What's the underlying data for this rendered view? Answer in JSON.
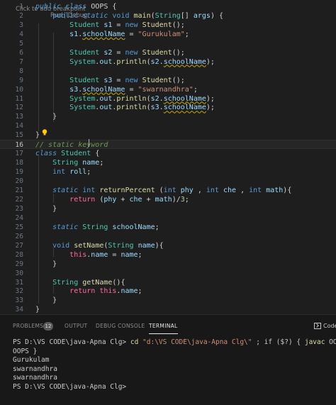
{
  "codelens": {
    "first": "Click to add breakpoint",
    "run_debug": "Run | Debug"
  },
  "code_lines": [
    {
      "n": "1",
      "t": [
        [
          "kw",
          "public"
        ],
        [
          "plain",
          " "
        ],
        [
          "kw",
          "class"
        ],
        [
          "plain",
          " OOPS {"
        ]
      ]
    },
    {
      "n": "2",
      "t": [
        [
          "plain",
          "    "
        ],
        [
          "kw2",
          "public"
        ],
        [
          "plain",
          " "
        ],
        [
          "kw",
          "static"
        ],
        [
          "plain",
          " "
        ],
        [
          "kw2",
          "void"
        ],
        [
          "plain",
          " "
        ],
        [
          "fn",
          "main"
        ],
        [
          "plain",
          "("
        ],
        [
          "ty",
          "String"
        ],
        [
          "plain",
          "[] "
        ],
        [
          "var",
          "args"
        ],
        [
          "plain",
          ") {"
        ]
      ]
    },
    {
      "n": "3",
      "t": [
        [
          "plain",
          "        "
        ],
        [
          "ty",
          "Student"
        ],
        [
          "plain",
          " "
        ],
        [
          "var",
          "s1"
        ],
        [
          "plain",
          " = "
        ],
        [
          "kw2",
          "new"
        ],
        [
          "plain",
          " "
        ],
        [
          "fn",
          "Student"
        ],
        [
          "plain",
          "();"
        ]
      ]
    },
    {
      "n": "4",
      "t": [
        [
          "plain",
          "        "
        ],
        [
          "var",
          "s1"
        ],
        [
          "plain",
          "."
        ],
        [
          "var warn",
          "schoolName"
        ],
        [
          "plain",
          " = "
        ],
        [
          "str",
          "\"Gurukulam\""
        ],
        [
          "plain",
          ";"
        ]
      ]
    },
    {
      "n": "5",
      "t": []
    },
    {
      "n": "6",
      "t": [
        [
          "plain",
          "        "
        ],
        [
          "ty",
          "Student"
        ],
        [
          "plain",
          " "
        ],
        [
          "var",
          "s2"
        ],
        [
          "plain",
          " = "
        ],
        [
          "kw2",
          "new"
        ],
        [
          "plain",
          " "
        ],
        [
          "fn",
          "Student"
        ],
        [
          "plain",
          "();"
        ]
      ]
    },
    {
      "n": "7",
      "t": [
        [
          "plain",
          "        "
        ],
        [
          "ty",
          "System"
        ],
        [
          "plain",
          "."
        ],
        [
          "var",
          "out"
        ],
        [
          "plain",
          "."
        ],
        [
          "fn",
          "println"
        ],
        [
          "plain",
          "("
        ],
        [
          "var",
          "s2"
        ],
        [
          "plain",
          "."
        ],
        [
          "var warn",
          "schoolName"
        ],
        [
          "plain",
          ");"
        ]
      ]
    },
    {
      "n": "8",
      "t": []
    },
    {
      "n": "9",
      "t": [
        [
          "plain",
          "        "
        ],
        [
          "ty",
          "Student"
        ],
        [
          "plain",
          " "
        ],
        [
          "var",
          "s3"
        ],
        [
          "plain",
          " = "
        ],
        [
          "kw2",
          "new"
        ],
        [
          "plain",
          " "
        ],
        [
          "fn",
          "Student"
        ],
        [
          "plain",
          "();"
        ]
      ]
    },
    {
      "n": "10",
      "t": [
        [
          "plain",
          "        "
        ],
        [
          "var",
          "s3"
        ],
        [
          "plain",
          "."
        ],
        [
          "var warn",
          "schoolName"
        ],
        [
          "plain",
          " = "
        ],
        [
          "str",
          "\"swarnandhra\""
        ],
        [
          "plain",
          ";"
        ]
      ]
    },
    {
      "n": "11",
      "t": [
        [
          "plain",
          "        "
        ],
        [
          "ty",
          "System"
        ],
        [
          "plain",
          "."
        ],
        [
          "var",
          "out"
        ],
        [
          "plain",
          "."
        ],
        [
          "fn",
          "println"
        ],
        [
          "plain",
          "("
        ],
        [
          "var",
          "s2"
        ],
        [
          "plain",
          "."
        ],
        [
          "var warn",
          "schoolName"
        ],
        [
          "plain",
          ");"
        ]
      ]
    },
    {
      "n": "12",
      "t": [
        [
          "plain",
          "        "
        ],
        [
          "ty",
          "System"
        ],
        [
          "plain",
          "."
        ],
        [
          "var",
          "out"
        ],
        [
          "plain",
          "."
        ],
        [
          "fn",
          "println"
        ],
        [
          "plain",
          "("
        ],
        [
          "var",
          "s3"
        ],
        [
          "plain",
          "."
        ],
        [
          "var warn",
          "schoolName"
        ],
        [
          "plain",
          ");"
        ]
      ]
    },
    {
      "n": "13",
      "t": [
        [
          "plain",
          "    }"
        ]
      ]
    },
    {
      "n": "14",
      "t": []
    },
    {
      "n": "15",
      "t": [
        [
          "plain",
          "}"
        ]
      ]
    },
    {
      "n": "16",
      "t": [
        [
          "com",
          "// static keyword"
        ]
      ]
    },
    {
      "n": "17",
      "t": [
        [
          "kw",
          "class"
        ],
        [
          "plain",
          " "
        ],
        [
          "ty",
          "Student"
        ],
        [
          "plain",
          " {"
        ]
      ]
    },
    {
      "n": "18",
      "t": [
        [
          "plain",
          "    "
        ],
        [
          "ty",
          "String"
        ],
        [
          "plain",
          " "
        ],
        [
          "var",
          "name"
        ],
        [
          "plain",
          ";"
        ]
      ]
    },
    {
      "n": "19",
      "t": [
        [
          "plain",
          "    "
        ],
        [
          "kw2",
          "int"
        ],
        [
          "plain",
          " "
        ],
        [
          "var",
          "roll"
        ],
        [
          "plain",
          ";"
        ]
      ]
    },
    {
      "n": "20",
      "t": []
    },
    {
      "n": "21",
      "t": [
        [
          "plain",
          "    "
        ],
        [
          "kw",
          "static"
        ],
        [
          "plain",
          " "
        ],
        [
          "kw2",
          "int"
        ],
        [
          "plain",
          " "
        ],
        [
          "fn",
          "returnPercent"
        ],
        [
          "plain",
          " ("
        ],
        [
          "kw2",
          "int"
        ],
        [
          "plain",
          " "
        ],
        [
          "var",
          "phy"
        ],
        [
          "plain",
          " , "
        ],
        [
          "kw2",
          "int"
        ],
        [
          "plain",
          " "
        ],
        [
          "var",
          "che"
        ],
        [
          "plain",
          " , "
        ],
        [
          "kw2",
          "int"
        ],
        [
          "plain",
          " "
        ],
        [
          "var",
          "math"
        ],
        [
          "plain",
          "){"
        ]
      ]
    },
    {
      "n": "22",
      "t": [
        [
          "plain",
          "        "
        ],
        [
          "th",
          "return"
        ],
        [
          "plain",
          " ("
        ],
        [
          "var",
          "phy"
        ],
        [
          "plain",
          " + "
        ],
        [
          "var",
          "che"
        ],
        [
          "plain",
          " + "
        ],
        [
          "var",
          "math"
        ],
        [
          "plain",
          ")/"
        ],
        [
          "num",
          "3"
        ],
        [
          "plain",
          ";"
        ]
      ]
    },
    {
      "n": "23",
      "t": [
        [
          "plain",
          "    }"
        ]
      ]
    },
    {
      "n": "24",
      "t": []
    },
    {
      "n": "25",
      "t": [
        [
          "plain",
          "    "
        ],
        [
          "kw",
          "static"
        ],
        [
          "plain",
          " "
        ],
        [
          "ty",
          "String"
        ],
        [
          "plain",
          " "
        ],
        [
          "var",
          "schoolName"
        ],
        [
          "plain",
          ";"
        ]
      ]
    },
    {
      "n": "26",
      "t": []
    },
    {
      "n": "27",
      "t": [
        [
          "plain",
          "    "
        ],
        [
          "kw2",
          "void"
        ],
        [
          "plain",
          " "
        ],
        [
          "fn",
          "setName"
        ],
        [
          "plain",
          "("
        ],
        [
          "ty",
          "String"
        ],
        [
          "plain",
          " "
        ],
        [
          "var",
          "name"
        ],
        [
          "plain",
          "){"
        ]
      ]
    },
    {
      "n": "28",
      "t": [
        [
          "plain",
          "        "
        ],
        [
          "th",
          "this"
        ],
        [
          "plain",
          "."
        ],
        [
          "var",
          "name"
        ],
        [
          "plain",
          " = "
        ],
        [
          "var",
          "name"
        ],
        [
          "plain",
          ";"
        ]
      ]
    },
    {
      "n": "29",
      "t": [
        [
          "plain",
          "    }"
        ]
      ]
    },
    {
      "n": "30",
      "t": []
    },
    {
      "n": "31",
      "t": [
        [
          "plain",
          "    "
        ],
        [
          "ty",
          "String"
        ],
        [
          "plain",
          " "
        ],
        [
          "fn",
          "getName"
        ],
        [
          "plain",
          "(){"
        ]
      ]
    },
    {
      "n": "32",
      "t": [
        [
          "plain",
          "        "
        ],
        [
          "th",
          "return"
        ],
        [
          "plain",
          " "
        ],
        [
          "th",
          "this"
        ],
        [
          "plain",
          "."
        ],
        [
          "var",
          "name"
        ],
        [
          "plain",
          ";"
        ]
      ]
    },
    {
      "n": "33",
      "t": [
        [
          "plain",
          "    }"
        ]
      ]
    },
    {
      "n": "34",
      "t": [
        [
          "plain",
          "}"
        ]
      ]
    }
  ],
  "panel": {
    "tabs": {
      "problems": "PROBLEMS",
      "problems_count": "12",
      "output": "OUTPUT",
      "debug_console": "DEBUG CONSOLE",
      "terminal": "TERMINAL"
    },
    "terminal_label": "Code"
  },
  "terminal": {
    "prompt1": "PS D:\\VS CODE\\java-Apna Clg> ",
    "cmd_cd": "cd",
    "cmd_path": " \"d:\\VS CODE\\java-Apna Clg\\\"",
    "cmd_mid": " ; if ($?) { ",
    "cmd_javac": "javac",
    "cmd_file": " OOPS.java",
    "cmd_line2": "OOPS }",
    "output": [
      "Gurukulam",
      "swarnandhra",
      "swarnandhra"
    ],
    "prompt2": "PS D:\\VS CODE\\java-Apna Clg> "
  },
  "colors": {
    "editor_bg": "#1e1e1e",
    "panel_bg": "#181818",
    "keyword": "#569cd6",
    "type": "#4ec9b0",
    "function": "#dcdcaa",
    "variable": "#9cdcfe",
    "string": "#ce9178",
    "comment": "#6a9955"
  }
}
